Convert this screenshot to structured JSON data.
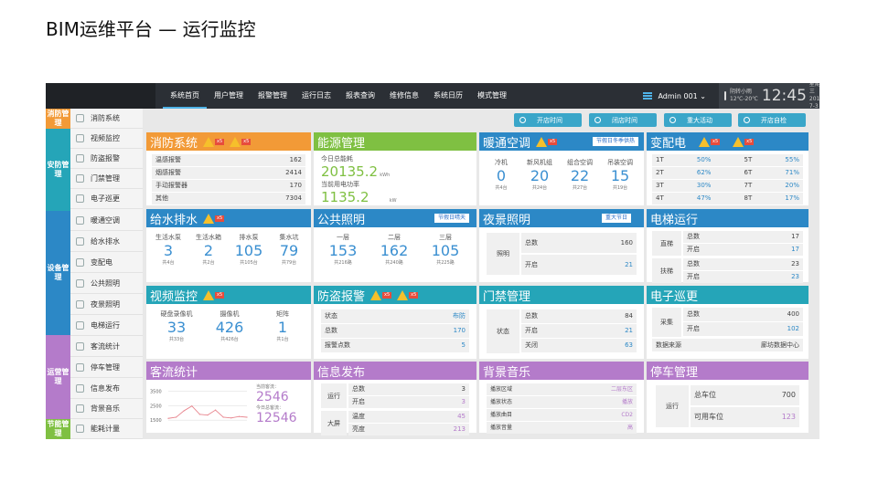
{
  "slide_title": "BIM运维平台 — 运行监控",
  "nav": {
    "items": [
      "系统首页",
      "用户管理",
      "报警管理",
      "运行日志",
      "报表查询",
      "维修信息",
      "系统日历",
      "模式管理"
    ],
    "admin": "Admin 001 ⌄",
    "weather": "阴转小雨",
    "temp": "12℃-20℃",
    "clock": "12:45",
    "weekday": "星期三",
    "date": "2013-7-3"
  },
  "sidebar": {
    "categories": [
      {
        "label": "消防管理",
        "color": "#f29a37"
      },
      {
        "label": "安防管理",
        "color": "#25a5b8"
      },
      {
        "label": "设备管理",
        "color": "#2c88c6"
      },
      {
        "label": "运营管理",
        "color": "#b47bca"
      },
      {
        "label": "节能管理",
        "color": "#7fc042"
      }
    ],
    "items": [
      "消防系统",
      "视频监控",
      "防盗报警",
      "门禁管理",
      "电子巡更",
      "暖通空调",
      "给水排水",
      "变配电",
      "公共照明",
      "夜景照明",
      "电梯运行",
      "客流统计",
      "停车管理",
      "信息发布",
      "背景音乐",
      "能耗计量"
    ]
  },
  "toolbar": [
    "开店时间",
    "闭店时间",
    "重大活动",
    "开店自检"
  ],
  "fire": {
    "title": "消防系统",
    "badge1": "x5",
    "badge2": "x5",
    "rows": [
      [
        "温感报警",
        "162"
      ],
      [
        "烟感报警",
        "2414"
      ],
      [
        "手动报警器",
        "170"
      ],
      [
        "其他",
        "7304"
      ]
    ]
  },
  "energy": {
    "title": "能源管理",
    "label1": "今日总能耗",
    "value1": "20135.2",
    "unit1": "kWh",
    "label2": "当前用电功率",
    "value2": "1135.2",
    "unit2": "kW"
  },
  "hvac": {
    "title": "暖通空调",
    "badge": "x5",
    "tag": "节假日冬季供热",
    "cols": [
      {
        "name": "冷机",
        "val": "0",
        "sub": "共4台"
      },
      {
        "name": "新风机组",
        "val": "20",
        "sub": "共24台"
      },
      {
        "name": "组合空调",
        "val": "22",
        "sub": "共27台"
      },
      {
        "name": "吊装空调",
        "val": "15",
        "sub": "共19台"
      }
    ]
  },
  "power": {
    "title": "变配电",
    "badge1": "x5",
    "badge2": "x5",
    "rows": [
      [
        "1T",
        "50%",
        "5T",
        "55%"
      ],
      [
        "2T",
        "62%",
        "6T",
        "71%"
      ],
      [
        "3T",
        "30%",
        "7T",
        "20%"
      ],
      [
        "4T",
        "47%",
        "8T",
        "17%"
      ]
    ]
  },
  "water": {
    "title": "给水排水",
    "badge": "x5",
    "cols": [
      {
        "name": "生活水泵",
        "val": "3",
        "sub": "共4台"
      },
      {
        "name": "生活水箱",
        "val": "2",
        "sub": "共2台"
      },
      {
        "name": "排水泵",
        "val": "105",
        "sub": "共105台"
      },
      {
        "name": "集水坑",
        "val": "79",
        "sub": "共79台"
      }
    ]
  },
  "lighting": {
    "title": "公共照明",
    "tag": "节假日晴天",
    "cols": [
      {
        "name": "一层",
        "val": "153",
        "sub": "共216路"
      },
      {
        "name": "二层",
        "val": "162",
        "sub": "共240路"
      },
      {
        "name": "三层",
        "val": "105",
        "sub": "共225路"
      }
    ]
  },
  "night": {
    "title": "夜景照明",
    "tag": "重大节日",
    "group": "照明",
    "rows": [
      [
        "总数",
        "160"
      ],
      [
        "开启",
        "21"
      ]
    ]
  },
  "elevator": {
    "title": "电梯运行",
    "groups": [
      {
        "name": "直梯",
        "rows": [
          [
            "总数",
            "17"
          ],
          [
            "开启",
            "17"
          ]
        ]
      },
      {
        "name": "扶梯",
        "rows": [
          [
            "总数",
            "23"
          ],
          [
            "开启",
            "23"
          ]
        ]
      }
    ]
  },
  "video": {
    "title": "视频监控",
    "badge": "x5",
    "cols": [
      {
        "name": "硬盘录像机",
        "val": "33",
        "sub": "共33台"
      },
      {
        "name": "摄像机",
        "val": "426",
        "sub": "共426台"
      },
      {
        "name": "矩阵",
        "val": "1",
        "sub": "共1台"
      }
    ]
  },
  "alarm": {
    "title": "防盗报警",
    "badge1": "x5",
    "badge2": "x5",
    "rows": [
      [
        "状态",
        "布防"
      ],
      [
        "总数",
        "170"
      ],
      [
        "报警点数",
        "5"
      ]
    ]
  },
  "access": {
    "title": "门禁管理",
    "group": "状态",
    "rows": [
      [
        "总数",
        "84"
      ],
      [
        "开启",
        "21"
      ],
      [
        "关闭",
        "63"
      ]
    ]
  },
  "patrol": {
    "title": "电子巡更",
    "group": "采集",
    "rows": [
      [
        "总数",
        "400"
      ],
      [
        "开启",
        "102"
      ]
    ],
    "src_label": "数据来源",
    "src_value": "廊坊数据中心"
  },
  "traffic": {
    "title": "客流统计",
    "label1": "当前客流：",
    "value1": "2546",
    "label2": "今日总客流：",
    "value2": "12546",
    "chart_data": {
      "type": "line",
      "yticks": [
        "3500",
        "2500",
        "1500"
      ],
      "ylim": [
        1000,
        3800
      ],
      "values": [
        1620,
        1700,
        2150,
        2480,
        1900,
        1850,
        2200,
        1700,
        1650,
        1750,
        1700
      ]
    }
  },
  "info": {
    "title": "信息发布",
    "groups": [
      {
        "name": "运行",
        "rows": [
          [
            "总数",
            "3"
          ],
          [
            "开启",
            "3"
          ]
        ]
      },
      {
        "name": "大屏",
        "rows": [
          [
            "温度",
            "45"
          ],
          [
            "亮度",
            "213"
          ]
        ]
      }
    ]
  },
  "music": {
    "title": "背景音乐",
    "rows": [
      [
        "播放区域",
        "二层东区"
      ],
      [
        "播放状态",
        "播放"
      ],
      [
        "播放曲目",
        "CD2"
      ],
      [
        "播放音量",
        "高"
      ]
    ]
  },
  "parking": {
    "title": "停车管理",
    "group": "运行",
    "rows": [
      [
        "总车位",
        "700"
      ],
      [
        "可用车位",
        "123"
      ]
    ]
  },
  "colors": {
    "orange": "#f29a37",
    "green": "#7fc042",
    "blue": "#2c88c6",
    "teal": "#25a5b8",
    "purple": "#b47bca"
  }
}
